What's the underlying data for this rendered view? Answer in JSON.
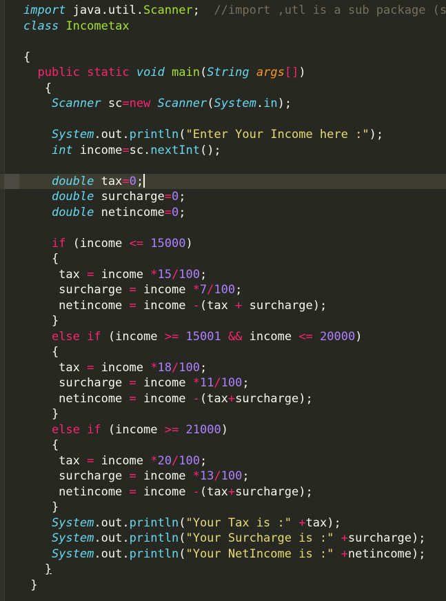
{
  "editor": {
    "active_line_index": 11,
    "lines": [
      [
        [
          "kwi",
          "import"
        ],
        [
          "pn",
          " java.util."
        ],
        [
          "cls",
          "Scanner"
        ],
        [
          "pn",
          ";"
        ],
        [
          "pn",
          "  "
        ],
        [
          "cm",
          "//import ,utl is a sub package (s"
        ]
      ],
      [
        [
          "kwi",
          "class"
        ],
        [
          "pn",
          " "
        ],
        [
          "cls",
          "Incometax"
        ]
      ],
      [],
      [
        [
          "pn",
          "{"
        ]
      ],
      [
        [
          "pn",
          "  "
        ],
        [
          "kw",
          "public"
        ],
        [
          "pn",
          " "
        ],
        [
          "kw",
          "static"
        ],
        [
          "pn",
          " "
        ],
        [
          "kwi",
          "void"
        ],
        [
          "pn",
          " "
        ],
        [
          "cls",
          "main"
        ],
        [
          "pn",
          "("
        ],
        [
          "kwi",
          "String"
        ],
        [
          "pn",
          " "
        ],
        [
          "arg",
          "args"
        ],
        [
          "op",
          "[]"
        ],
        [
          "pn",
          ")"
        ]
      ],
      [
        [
          "pn",
          "   "
        ],
        [
          "pn",
          "{"
        ]
      ],
      [
        [
          "pn",
          "    "
        ],
        [
          "kwi",
          "Scanner"
        ],
        [
          "pn",
          " sc"
        ],
        [
          "op",
          "="
        ],
        [
          "kw",
          "new"
        ],
        [
          "pn",
          " "
        ],
        [
          "kwi",
          "Scanner"
        ],
        [
          "pn",
          "("
        ],
        [
          "kwi",
          "System"
        ],
        [
          "pn",
          "."
        ],
        [
          "fn",
          "in"
        ],
        [
          "pn",
          ");"
        ]
      ],
      [],
      [
        [
          "pn",
          "    "
        ],
        [
          "kwi",
          "System"
        ],
        [
          "pn",
          ".out."
        ],
        [
          "fn",
          "println"
        ],
        [
          "pn",
          "("
        ],
        [
          "str",
          "\"Enter Your Income here :\""
        ],
        [
          "pn",
          ");"
        ]
      ],
      [
        [
          "pn",
          "    "
        ],
        [
          "kwi",
          "int"
        ],
        [
          "pn",
          " income"
        ],
        [
          "op",
          "="
        ],
        [
          "pn",
          "sc."
        ],
        [
          "fn",
          "nextInt"
        ],
        [
          "pn",
          "();"
        ]
      ],
      [],
      [
        [
          "pn",
          "    "
        ],
        [
          "kwi",
          "double"
        ],
        [
          "pn",
          " tax"
        ],
        [
          "op",
          "="
        ],
        [
          "num",
          "0"
        ],
        [
          "pn",
          ";"
        ],
        [
          "cursor",
          ""
        ]
      ],
      [
        [
          "pn",
          "    "
        ],
        [
          "kwi",
          "double"
        ],
        [
          "pn",
          " surcharge"
        ],
        [
          "op",
          "="
        ],
        [
          "num",
          "0"
        ],
        [
          "pn",
          ";"
        ]
      ],
      [
        [
          "pn",
          "    "
        ],
        [
          "kwi",
          "double"
        ],
        [
          "pn",
          " netincome"
        ],
        [
          "op",
          "="
        ],
        [
          "num",
          "0"
        ],
        [
          "pn",
          ";"
        ]
      ],
      [],
      [
        [
          "pn",
          "    "
        ],
        [
          "kw",
          "if"
        ],
        [
          "pn",
          " (income "
        ],
        [
          "op",
          "<="
        ],
        [
          "pn",
          " "
        ],
        [
          "num",
          "15000"
        ],
        [
          "pn",
          ")"
        ]
      ],
      [
        [
          "pn",
          "    {"
        ]
      ],
      [
        [
          "pn",
          "     tax "
        ],
        [
          "op",
          "="
        ],
        [
          "pn",
          " income "
        ],
        [
          "op",
          "*"
        ],
        [
          "num",
          "15"
        ],
        [
          "op",
          "/"
        ],
        [
          "num",
          "100"
        ],
        [
          "pn",
          ";"
        ]
      ],
      [
        [
          "pn",
          "     surcharge "
        ],
        [
          "op",
          "="
        ],
        [
          "pn",
          " income "
        ],
        [
          "op",
          "*"
        ],
        [
          "num",
          "7"
        ],
        [
          "op",
          "/"
        ],
        [
          "num",
          "100"
        ],
        [
          "pn",
          ";"
        ]
      ],
      [
        [
          "pn",
          "     netincome "
        ],
        [
          "op",
          "="
        ],
        [
          "pn",
          " income "
        ],
        [
          "op",
          "-"
        ],
        [
          "pn",
          "(tax "
        ],
        [
          "op",
          "+"
        ],
        [
          "pn",
          " surcharge);"
        ]
      ],
      [
        [
          "pn",
          "    }"
        ]
      ],
      [
        [
          "pn",
          "    "
        ],
        [
          "kw",
          "else"
        ],
        [
          "pn",
          " "
        ],
        [
          "kw",
          "if"
        ],
        [
          "pn",
          " (income "
        ],
        [
          "op",
          ">="
        ],
        [
          "pn",
          " "
        ],
        [
          "num",
          "15001"
        ],
        [
          "pn",
          " "
        ],
        [
          "op",
          "&&"
        ],
        [
          "pn",
          " income "
        ],
        [
          "op",
          "<="
        ],
        [
          "pn",
          " "
        ],
        [
          "num",
          "20000"
        ],
        [
          "pn",
          ")"
        ]
      ],
      [
        [
          "pn",
          "    {"
        ]
      ],
      [
        [
          "pn",
          "     tax "
        ],
        [
          "op",
          "="
        ],
        [
          "pn",
          " income "
        ],
        [
          "op",
          "*"
        ],
        [
          "num",
          "18"
        ],
        [
          "op",
          "/"
        ],
        [
          "num",
          "100"
        ],
        [
          "pn",
          ";"
        ]
      ],
      [
        [
          "pn",
          "     surcharge "
        ],
        [
          "op",
          "="
        ],
        [
          "pn",
          " income "
        ],
        [
          "op",
          "*"
        ],
        [
          "num",
          "11"
        ],
        [
          "op",
          "/"
        ],
        [
          "num",
          "100"
        ],
        [
          "pn",
          ";"
        ]
      ],
      [
        [
          "pn",
          "     netincome "
        ],
        [
          "op",
          "="
        ],
        [
          "pn",
          " income "
        ],
        [
          "op",
          "-"
        ],
        [
          "pn",
          "(tax"
        ],
        [
          "op",
          "+"
        ],
        [
          "pn",
          "surcharge);"
        ]
      ],
      [
        [
          "pn",
          "    }"
        ]
      ],
      [
        [
          "pn",
          "    "
        ],
        [
          "kw",
          "else"
        ],
        [
          "pn",
          " "
        ],
        [
          "kw",
          "if"
        ],
        [
          "pn",
          " (income "
        ],
        [
          "op",
          ">="
        ],
        [
          "pn",
          " "
        ],
        [
          "num",
          "21000"
        ],
        [
          "pn",
          ")"
        ]
      ],
      [
        [
          "pn",
          "    {"
        ]
      ],
      [
        [
          "pn",
          "     tax "
        ],
        [
          "op",
          "="
        ],
        [
          "pn",
          " income "
        ],
        [
          "op",
          "*"
        ],
        [
          "num",
          "20"
        ],
        [
          "op",
          "/"
        ],
        [
          "num",
          "100"
        ],
        [
          "pn",
          ";"
        ]
      ],
      [
        [
          "pn",
          "     surcharge "
        ],
        [
          "op",
          "="
        ],
        [
          "pn",
          " income "
        ],
        [
          "op",
          "*"
        ],
        [
          "num",
          "13"
        ],
        [
          "op",
          "/"
        ],
        [
          "num",
          "100"
        ],
        [
          "pn",
          ";"
        ]
      ],
      [
        [
          "pn",
          "     netincome "
        ],
        [
          "op",
          "="
        ],
        [
          "pn",
          " income "
        ],
        [
          "op",
          "-"
        ],
        [
          "pn",
          "(tax"
        ],
        [
          "op",
          "+"
        ],
        [
          "pn",
          "surcharge);"
        ]
      ],
      [
        [
          "pn",
          "    }"
        ]
      ],
      [
        [
          "pn",
          "    "
        ],
        [
          "kwi",
          "System"
        ],
        [
          "pn",
          ".out."
        ],
        [
          "fn",
          "println"
        ],
        [
          "pn",
          "("
        ],
        [
          "str",
          "\"Your Tax is :\""
        ],
        [
          "pn",
          " "
        ],
        [
          "op",
          "+"
        ],
        [
          "pn",
          "tax);"
        ]
      ],
      [
        [
          "pn",
          "    "
        ],
        [
          "kwi",
          "System"
        ],
        [
          "pn",
          ".out."
        ],
        [
          "fn",
          "println"
        ],
        [
          "pn",
          "("
        ],
        [
          "str",
          "\"Your Surcharge is :\""
        ],
        [
          "pn",
          " "
        ],
        [
          "op",
          "+"
        ],
        [
          "pn",
          "surcharge);"
        ]
      ],
      [
        [
          "pn",
          "    "
        ],
        [
          "kwi",
          "System"
        ],
        [
          "pn",
          ".out."
        ],
        [
          "fn",
          "println"
        ],
        [
          "pn",
          "("
        ],
        [
          "str",
          "\"Your NetIncome is :\""
        ],
        [
          "pn",
          " "
        ],
        [
          "op",
          "+"
        ],
        [
          "pn",
          "netincome);"
        ]
      ],
      [
        [
          "pn",
          "   "
        ],
        [
          "ul",
          "}"
        ]
      ],
      [
        [
          "pn",
          " }"
        ]
      ]
    ]
  }
}
